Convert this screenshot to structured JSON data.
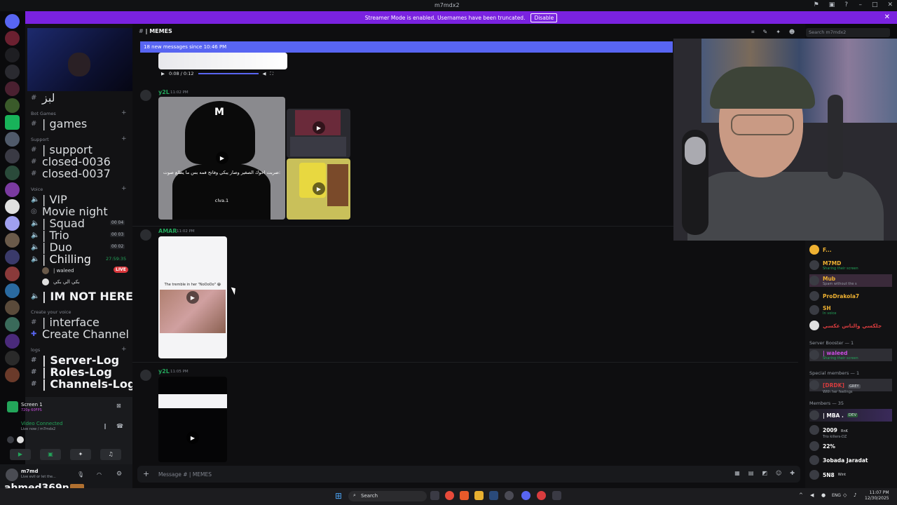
{
  "window": {
    "title": "m7mdx2"
  },
  "banner": {
    "text": "Streamer Mode is enabled. Usernames have been truncated.",
    "disable_label": "Disable"
  },
  "header": {
    "channel": "| MEMES",
    "search_placeholder": "Search m7mdx2"
  },
  "new_messages": "18 new messages since 10:46 PM",
  "sidebar": {
    "top_channel": "لبز",
    "categories": {
      "bot_games": "Bot Games",
      "support": "Support",
      "voice": "Voice",
      "create_voice": "Create your voice",
      "logs": "logs"
    },
    "channels": {
      "games": "| games",
      "support": "| support",
      "closed1": "closed-0036",
      "closed2": "closed-0037",
      "vip": "| VIP",
      "movie": "Movie night",
      "squad": "| Squad",
      "trio": "| Trio",
      "duo": "| Duo",
      "chilling": "| Chilling",
      "user1": "| waleed",
      "user2": "بكي الي بكي",
      "not_here": "| IM NOT HERE",
      "interface": "| interface",
      "create": "Create Channel",
      "server_log": "| Server-Log",
      "roles_log": "| Roles-Log",
      "channels_log": "| Channels-Log"
    },
    "counts": {
      "squad": "00 04",
      "trio": "00 03",
      "duo": "00 02"
    },
    "chilling_timer": "27:59:35",
    "live_badge": "LIVE"
  },
  "voice": {
    "screen_label": "Screen 1",
    "screen_sub": "720p 60FPS",
    "connected": "Video Connected",
    "connected_sub": "Live now / m7mdx2"
  },
  "user": {
    "name": "m7md",
    "status": "Live evil or let the..."
  },
  "watermark": "ahmed369n",
  "messages": [
    {
      "author": "",
      "audio_time": "0:08 / 0:12"
    },
    {
      "author": "y2L",
      "time": "11:02 PM",
      "caption_ar": "ضربت اخوك الصغير وصار يبكي وفاتح فمه بس ما يطلع صوت:",
      "caption_user": "clva.1"
    },
    {
      "author": "AMAR",
      "time": "11:02 PM",
      "caption": "The tremble in her \"NoOoOo\" 😭"
    },
    {
      "author": "y2L",
      "time": "11:05 PM"
    }
  ],
  "input": {
    "placeholder": "Message # | MEMES"
  },
  "members": {
    "online": [
      {
        "name": "F...",
        "status": "",
        "color": "#f0b232"
      },
      {
        "name": "M7MD",
        "status": "Sharing their screen",
        "color": "#f0b232"
      },
      {
        "name": "Mub",
        "status": "Spam without the s",
        "color": "#f0b232"
      },
      {
        "name": "ProDrakola7",
        "status": "",
        "color": "#f0b232"
      },
      {
        "name": "SH",
        "status": "In voice",
        "color": "#f0b232"
      },
      {
        "name": "جلكسي والناس عكسي",
        "status": "",
        "color": "#d83c3e"
      }
    ],
    "booster_header": "Server Booster — 1",
    "booster": {
      "name": "| waleed",
      "status": "Sharing their screen",
      "color": "#c94ce0"
    },
    "special_header": "Special members — 1",
    "special": {
      "name": "[DRDK]",
      "status": "With her feelings",
      "color": "#d83c3e",
      "tag": "GREY"
    },
    "members_header": "Members — 35",
    "list": [
      {
        "name": "| MBA .",
        "tag": "DEV",
        "color": "#ffffff"
      },
      {
        "name": "2009",
        "tag": "RnK",
        "sub": "Trio killers-DZ",
        "color": "#ffffff"
      },
      {
        "name": "22%",
        "color": "#ffffff"
      },
      {
        "name": "3obada Jaradat",
        "color": "#ffffff"
      },
      {
        "name": "5N8",
        "tag": "Wint",
        "color": "#ffffff"
      }
    ]
  },
  "taskbar": {
    "search": "Search",
    "lang": "ENG",
    "time": "11:07 PM",
    "date": "12/30/2025"
  },
  "colors": {
    "accent": "#5865f2",
    "banner": "#7a22e0",
    "green": "#23a55a",
    "live": "#da373c"
  }
}
